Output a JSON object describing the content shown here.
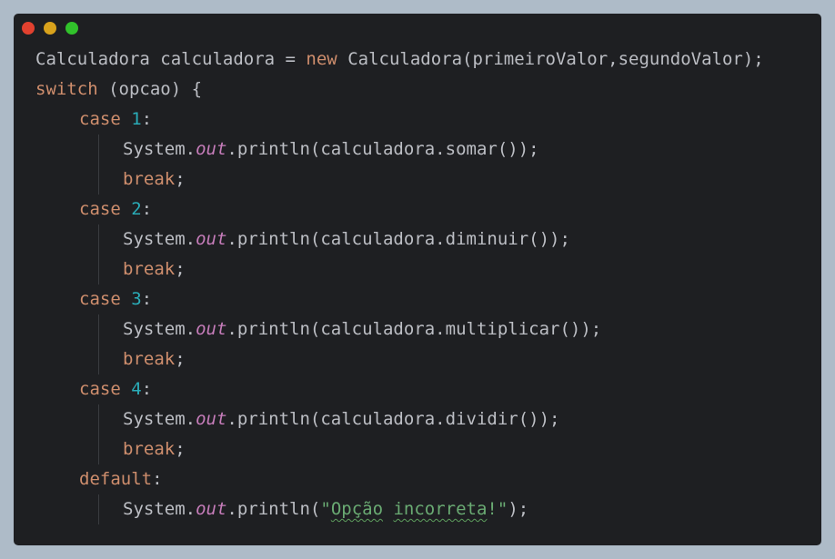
{
  "window": {
    "controls": [
      "close",
      "minimize",
      "maximize"
    ],
    "colors": {
      "close": "#e2412f",
      "minimize": "#d9a21c",
      "maximize": "#31c22b",
      "background": "#1e1f22"
    }
  },
  "code": {
    "l1": {
      "a": "Calculadora calculadora = ",
      "b": "new",
      "c": " Calculadora(primeiroValor,segundoValor);"
    },
    "l2": {
      "a": "switch",
      "b": " (opcao) {"
    },
    "cases": [
      {
        "kw": "case",
        "num": "1",
        "colon": ":",
        "sys": "System.",
        "out": "out",
        "call": ".println(calculadora.somar());",
        "brk": "break",
        "semi": ";"
      },
      {
        "kw": "case",
        "num": "2",
        "colon": ":",
        "sys": "System.",
        "out": "out",
        "call": ".println(calculadora.diminuir());",
        "brk": "break",
        "semi": ";"
      },
      {
        "kw": "case",
        "num": "3",
        "colon": ":",
        "sys": "System.",
        "out": "out",
        "call": ".println(calculadora.multiplicar());",
        "brk": "break",
        "semi": ";"
      },
      {
        "kw": "case",
        "num": "4",
        "colon": ":",
        "sys": "System.",
        "out": "out",
        "call": ".println(calculadora.dividir());",
        "brk": "break",
        "semi": ";"
      }
    ],
    "default": {
      "kw": "default",
      "colon": ":",
      "sys": "System.",
      "out": "out",
      "open": ".println(",
      "q1": "\"",
      "w1": "Opção",
      "sp": " ",
      "w2": "incorreta",
      "q2": "!\"",
      "close": ");"
    }
  }
}
